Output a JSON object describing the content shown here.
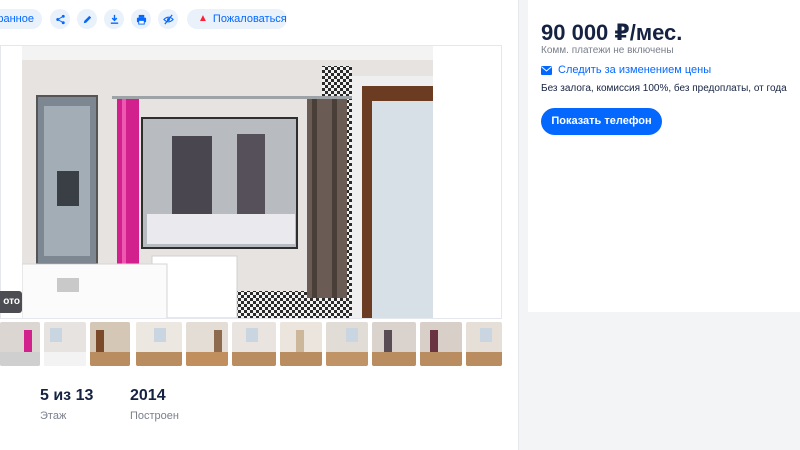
{
  "toolbar": {
    "favorite_label": "ранное",
    "report_label": "Пожаловаться",
    "icons": [
      "share-icon",
      "edit-icon",
      "download-icon",
      "print-icon",
      "hide-icon"
    ]
  },
  "gallery": {
    "badge_label": "ото",
    "thumb_count": 11
  },
  "facts": [
    {
      "value": "5 из 13",
      "label": "Этаж"
    },
    {
      "value": "2014",
      "label": "Построен"
    }
  ],
  "offer": {
    "price": "90 000 ₽/мес.",
    "note": "Комм. платежи не включены",
    "follow_label": "Следить за изменением цены",
    "terms": "Без залога, комиссия 100%, без предоплаты, от года",
    "phone_button": "Показать телефон"
  },
  "colors": {
    "accent": "#0468ff",
    "accent_light": "#e9f1fb",
    "warning": "#ff1f34",
    "text": "#152242",
    "muted": "#7a7f8c"
  }
}
